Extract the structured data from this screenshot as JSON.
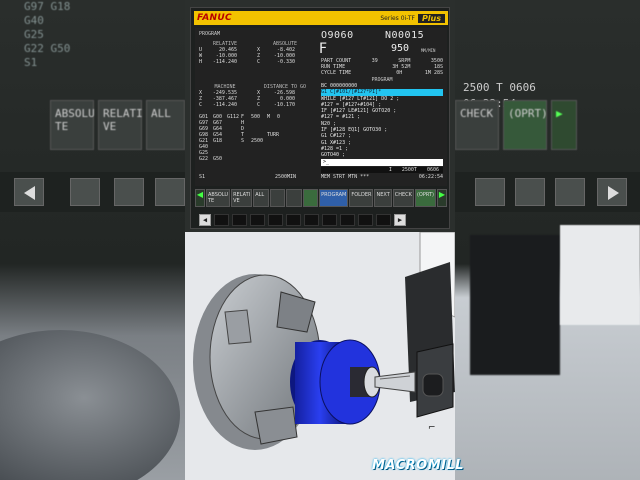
{
  "background": {
    "left_codes": [
      "G97  G18",
      "G40",
      "G25",
      "G22  G50",
      "",
      "S1"
    ],
    "left_buttons": [
      "ABSOLU TE",
      "RELATI VE",
      "ALL"
    ],
    "right_status": [
      "2500 T      0606",
      "06:22:54"
    ],
    "right_buttons": [
      "CHECK",
      "(OPRT)"
    ]
  },
  "header": {
    "brand": "FANUC",
    "series": "Series 0i-TF",
    "plus": "Plus"
  },
  "screen": {
    "title": "PROGRAM",
    "o_number": "O9060",
    "n_number": "N00015",
    "relative": {
      "label": "RELATIVE",
      "rows": [
        {
          "axis": "U",
          "value": "20.465"
        },
        {
          "axis": "W",
          "value": "-10.000"
        },
        {
          "axis": "H",
          "value": "-114.240"
        }
      ]
    },
    "absolute": {
      "label": "ABSOLUTE",
      "rows": [
        {
          "axis": "X",
          "value": "-8.402"
        },
        {
          "axis": "Z",
          "value": "-10.000"
        },
        {
          "axis": "C",
          "value": "-0.330"
        }
      ]
    },
    "machine": {
      "label": "MACHINE",
      "rows": [
        {
          "axis": "X",
          "value": "-249.535"
        },
        {
          "axis": "Z",
          "value": "-387.467"
        },
        {
          "axis": "C",
          "value": "-114.240"
        }
      ]
    },
    "distance": {
      "label": "DISTANCE TO GO",
      "rows": [
        {
          "axis": "X",
          "value": "-26.598"
        },
        {
          "axis": "Z",
          "value": "0.000"
        },
        {
          "axis": "C",
          "value": "-10.170"
        }
      ]
    },
    "feed": {
      "letter": "F",
      "value": "950",
      "unit": "MM/MIN"
    },
    "counts": [
      {
        "label": "PART COUNT",
        "value": "39",
        "extra": "SRPM",
        "value2": "3500"
      },
      {
        "label": "RUN TIME",
        "value": "",
        "extra": "3H 52M",
        "value2": "18S"
      },
      {
        "label": "CYCLE TIME",
        "value": "",
        "extra": "0H",
        "value2": "1M 28S"
      }
    ],
    "modal_codes": [
      [
        "G01",
        "G00",
        "G112",
        "F",
        "500",
        "M",
        "0"
      ],
      [
        "G97",
        "G67",
        "",
        "H",
        "",
        "",
        ""
      ],
      [
        "G69",
        "G64",
        "",
        "D",
        "",
        "",
        ""
      ],
      [
        "G98",
        "G54",
        "",
        "T",
        "",
        "TURR",
        ""
      ],
      [
        "G21",
        "G18",
        "",
        "S",
        "2500",
        "",
        ""
      ],
      [
        "G40",
        "",
        "",
        "",
        "",
        "",
        ""
      ],
      [
        "G25",
        "",
        "",
        "",
        "",
        "",
        ""
      ],
      [
        "G22",
        "G50",
        "",
        "",
        "",
        "",
        ""
      ]
    ],
    "program_label": "PROGRAM",
    "program_lines": [
      "BC 000000000",
      "G1 C[#101/[#127*PI]*",
      "WHILE [#127 LT#121] DO 2 ;",
      "#127 = [#127+#104] ;",
      "IF [#127 LE#121] GOTO20 ;",
      "#127 = #121 ;",
      "N20 ;",
      "IF [#128 EQ1] GOTO30 ;",
      "G1 C#127 ;",
      "G1 X#123 ;",
      "#128 =1 ;",
      "GOTO40 ;",
      "N30 ;"
    ],
    "highlight_index": 1,
    "prompt": ">_",
    "cmd_bar": [
      "I",
      "2500T",
      "0606"
    ],
    "status_left": "S1",
    "status_sp": "2500MIN",
    "status_mode": "MEM STRT MTN ***",
    "status_time": "06:22:54"
  },
  "softkeys": [
    {
      "label": "ABSOLU TE",
      "style": "normal"
    },
    {
      "label": "RELATI VE",
      "style": "normal"
    },
    {
      "label": "ALL",
      "style": "normal"
    },
    {
      "label": "",
      "style": "normal"
    },
    {
      "label": "",
      "style": "normal"
    },
    {
      "label": "",
      "style": "green"
    },
    {
      "label": "PROGRAM",
      "style": "blue"
    },
    {
      "label": "FOLDER",
      "style": "normal"
    },
    {
      "label": "NEXT",
      "style": "normal"
    },
    {
      "label": "CHECK",
      "style": "normal"
    },
    {
      "label": "(OPRT)",
      "style": "green"
    }
  ],
  "watermark": "MACROMILL",
  "colors": {
    "brand_yellow": "#f2c200",
    "highlight_cyan": "#22c4f0",
    "part_blue": "#1b2fd6"
  }
}
